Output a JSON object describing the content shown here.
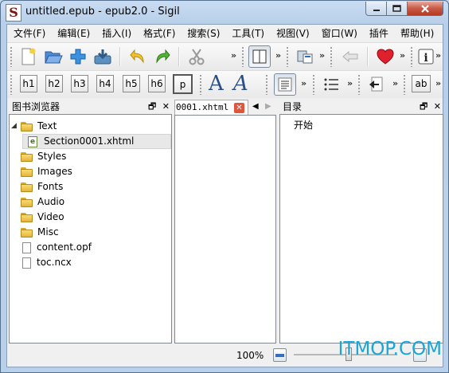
{
  "window": {
    "title": "untitled.epub - epub2.0 - Sigil",
    "app_icon_letter": "S"
  },
  "menu": [
    "文件(F)",
    "编辑(E)",
    "插入(I)",
    "格式(F)",
    "搜索(S)",
    "工具(T)",
    "视图(V)",
    "窗口(W)",
    "插件",
    "帮助(H)"
  ],
  "toolbar_icons": [
    "new-file-icon",
    "open-folder-icon",
    "add-icon",
    "save-icon",
    "undo-icon",
    "redo-icon",
    "cut-icon",
    "book-view-icon",
    "split-view-icon",
    "back-arrow-icon",
    "heart-icon",
    "info-icon"
  ],
  "heading_buttons": [
    "h1",
    "h2",
    "h3",
    "h4",
    "h5",
    "h6",
    "p"
  ],
  "font_buttons": {
    "bold_A": "A",
    "italic_A": "A"
  },
  "text_button": "ab",
  "overflow": "»",
  "book_browser": {
    "title": "图书浏览器",
    "items": [
      {
        "label": "Text",
        "type": "folder",
        "expanded": true
      },
      {
        "label": "Section0001.xhtml",
        "type": "xhtml",
        "selected": true
      },
      {
        "label": "Styles",
        "type": "folder"
      },
      {
        "label": "Images",
        "type": "folder"
      },
      {
        "label": "Fonts",
        "type": "folder"
      },
      {
        "label": "Audio",
        "type": "folder"
      },
      {
        "label": "Video",
        "type": "folder"
      },
      {
        "label": "Misc",
        "type": "folder"
      },
      {
        "label": "content.opf",
        "type": "file"
      },
      {
        "label": "toc.ncx",
        "type": "file"
      }
    ]
  },
  "editor_tab": {
    "label": "0001.xhtml"
  },
  "toc": {
    "title": "目录",
    "items": [
      "开始"
    ]
  },
  "status": {
    "zoom": "100%"
  },
  "watermark": "ITMOP.COM",
  "colors": {
    "title_bar": "#c9dcf2",
    "close_button": "#c75a46",
    "accent_blue": "#2a4f86",
    "watermark": "#1aa5d9"
  }
}
